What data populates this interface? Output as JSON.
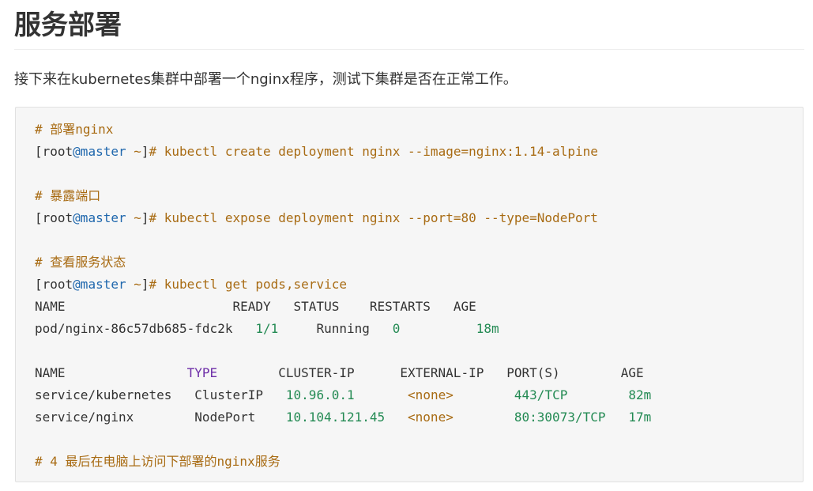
{
  "section": {
    "title": "服务部署",
    "intro": "接下来在kubernetes集群中部署一个nginx程序，测试下集群是否在正常工作。"
  },
  "code": {
    "comment1": "# 部署nginx",
    "prompt_open": "[root",
    "prompt_at_host": "@master",
    "prompt_tilde": " ~",
    "prompt_close": "]",
    "cmd1": "# kubectl create deployment nginx --image=nginx:1.14-alpine",
    "comment2": "# 暴露端口",
    "cmd2": "# kubectl expose deployment nginx --port=80 --type=NodePort",
    "comment3": "# 查看服务状态",
    "cmd3": "# kubectl get pods,service",
    "pods_table": {
      "headers": [
        "NAME",
        "READY",
        "STATUS",
        "RESTARTS",
        "AGE"
      ],
      "rows": [
        [
          "pod/nginx-86c57db685-fdc2k",
          "1/1",
          "Running",
          "0",
          "18m"
        ]
      ]
    },
    "services_table": {
      "headers": [
        "NAME",
        "TYPE",
        "CLUSTER-IP",
        "EXTERNAL-IP",
        "PORT(S)",
        "AGE"
      ],
      "rows": [
        [
          "service/kubernetes",
          "ClusterIP",
          "10.96.0.1",
          "<none>",
          "443/TCP",
          "82m"
        ],
        [
          "service/nginx",
          "NodePort",
          "10.104.121.45",
          "<none>",
          "80:30073/TCP",
          "17m"
        ]
      ]
    },
    "comment4": "# 4 最后在电脑上访问下部署的nginx服务"
  },
  "colors": {
    "comment": "#a86b13",
    "hostname": "#1f67ad",
    "number": "#238a53",
    "keyword": "#6e2fa8",
    "code_background": "#f6f6f6"
  }
}
